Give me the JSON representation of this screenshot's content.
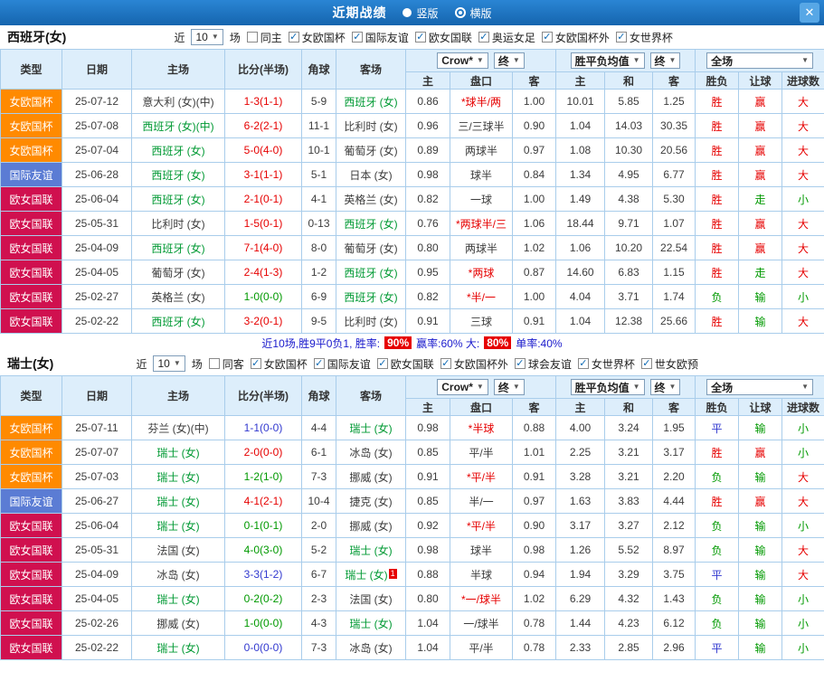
{
  "titlebar": {
    "title": "近期战绩",
    "radio_vertical": "竖版",
    "radio_horizontal": "横版",
    "close": "✕"
  },
  "colors": {
    "type_badge": {
      "女欧国杯": "#ff8a00",
      "国际友谊": "#5b7cd4",
      "欧女国联": "#d0104f"
    },
    "result": {
      "胜": "#e60000",
      "平": "#3239cf",
      "负": "#009900",
      "赢": "#e60000",
      "走": "#009900",
      "输": "#009900",
      "大": "#e60000",
      "小": "#009900"
    },
    "score": {
      "win": "#e60000",
      "draw": "#3239cf",
      "loss": "#009900"
    },
    "team_highlight": "#009933",
    "text": "#3c3c3c",
    "odds": "#3c3c3c",
    "line_star": "#e60000",
    "badge_bg": "#e60000"
  },
  "header": {
    "col_type": "类型",
    "col_date": "日期",
    "col_home": "主场",
    "col_score": "比分(半场)",
    "col_corner": "角球",
    "col_away": "客场",
    "dd_odds": "Crow*",
    "dd_final": "终",
    "dd_avg": "胜平负均值",
    "dd_scope": "全场",
    "sub": [
      "主",
      "盘口",
      "客",
      "主",
      "和",
      "客",
      "胜负",
      "让球",
      "进球数"
    ]
  },
  "sections": [
    {
      "team": "西班牙(女)",
      "filters": {
        "near_label": "近",
        "count": "10",
        "games_label": "场",
        "same": {
          "label": "同主",
          "checked": false
        },
        "leagues": [
          {
            "label": "女欧国杯",
            "checked": true
          },
          {
            "label": "国际友谊",
            "checked": true
          },
          {
            "label": "欧女国联",
            "checked": true
          },
          {
            "label": "奥运女足",
            "checked": true
          },
          {
            "label": "女欧国杯外",
            "checked": true
          },
          {
            "label": "女世界杯",
            "checked": true
          }
        ]
      },
      "rows": [
        {
          "type": "女欧国杯",
          "date": "25-07-12",
          "home": "意大利 (女)(中)",
          "home_hl": false,
          "score": "1-3(1-1)",
          "res": "win",
          "corner": "5-9",
          "away": "西班牙 (女)",
          "away_hl": true,
          "h": "0.86",
          "line": "*球半/两",
          "a": "1.00",
          "wh": "10.01",
          "wd": "5.85",
          "wa": "1.25",
          "r1": "胜",
          "r2": "赢",
          "r3": "大"
        },
        {
          "type": "女欧国杯",
          "date": "25-07-08",
          "home": "西班牙 (女)(中)",
          "home_hl": true,
          "score": "6-2(2-1)",
          "res": "win",
          "corner": "11-1",
          "away": "比利时 (女)",
          "away_hl": false,
          "h": "0.96",
          "line": "三/三球半",
          "a": "0.90",
          "wh": "1.04",
          "wd": "14.03",
          "wa": "30.35",
          "r1": "胜",
          "r2": "赢",
          "r3": "大"
        },
        {
          "type": "女欧国杯",
          "date": "25-07-04",
          "home": "西班牙 (女)",
          "home_hl": true,
          "score": "5-0(4-0)",
          "res": "win",
          "corner": "10-1",
          "away": "葡萄牙 (女)",
          "away_hl": false,
          "h": "0.89",
          "line": "两球半",
          "a": "0.97",
          "wh": "1.08",
          "wd": "10.30",
          "wa": "20.56",
          "r1": "胜",
          "r2": "赢",
          "r3": "大"
        },
        {
          "type": "国际友谊",
          "date": "25-06-28",
          "home": "西班牙 (女)",
          "home_hl": true,
          "score": "3-1(1-1)",
          "res": "win",
          "corner": "5-1",
          "away": "日本 (女)",
          "away_hl": false,
          "h": "0.98",
          "line": "球半",
          "a": "0.84",
          "wh": "1.34",
          "wd": "4.95",
          "wa": "6.77",
          "r1": "胜",
          "r2": "赢",
          "r3": "大"
        },
        {
          "type": "欧女国联",
          "date": "25-06-04",
          "home": "西班牙 (女)",
          "home_hl": true,
          "score": "2-1(0-1)",
          "res": "win",
          "corner": "4-1",
          "away": "英格兰 (女)",
          "away_hl": false,
          "h": "0.82",
          "line": "一球",
          "a": "1.00",
          "wh": "1.49",
          "wd": "4.38",
          "wa": "5.30",
          "r1": "胜",
          "r2": "走",
          "r3": "小"
        },
        {
          "type": "欧女国联",
          "date": "25-05-31",
          "home": "比利时 (女)",
          "home_hl": false,
          "score": "1-5(0-1)",
          "res": "win",
          "corner": "0-13",
          "away": "西班牙 (女)",
          "away_hl": true,
          "h": "0.76",
          "line": "*两球半/三",
          "a": "1.06",
          "wh": "18.44",
          "wd": "9.71",
          "wa": "1.07",
          "r1": "胜",
          "r2": "赢",
          "r3": "大"
        },
        {
          "type": "欧女国联",
          "date": "25-04-09",
          "home": "西班牙 (女)",
          "home_hl": true,
          "score": "7-1(4-0)",
          "res": "win",
          "corner": "8-0",
          "away": "葡萄牙 (女)",
          "away_hl": false,
          "h": "0.80",
          "line": "两球半",
          "a": "1.02",
          "wh": "1.06",
          "wd": "10.20",
          "wa": "22.54",
          "r1": "胜",
          "r2": "赢",
          "r3": "大"
        },
        {
          "type": "欧女国联",
          "date": "25-04-05",
          "home": "葡萄牙 (女)",
          "home_hl": false,
          "score": "2-4(1-3)",
          "res": "win",
          "corner": "1-2",
          "away": "西班牙 (女)",
          "away_hl": true,
          "h": "0.95",
          "line": "*两球",
          "a": "0.87",
          "wh": "14.60",
          "wd": "6.83",
          "wa": "1.15",
          "r1": "胜",
          "r2": "走",
          "r3": "大"
        },
        {
          "type": "欧女国联",
          "date": "25-02-27",
          "home": "英格兰 (女)",
          "home_hl": false,
          "score": "1-0(0-0)",
          "res": "loss",
          "corner": "6-9",
          "away": "西班牙 (女)",
          "away_hl": true,
          "h": "0.82",
          "line": "*半/一",
          "a": "1.00",
          "wh": "4.04",
          "wd": "3.71",
          "wa": "1.74",
          "r1": "负",
          "r2": "输",
          "r3": "小"
        },
        {
          "type": "欧女国联",
          "date": "25-02-22",
          "home": "西班牙 (女)",
          "home_hl": true,
          "score": "3-2(0-1)",
          "res": "win",
          "corner": "9-5",
          "away": "比利时 (女)",
          "away_hl": false,
          "h": "0.91",
          "line": "三球",
          "a": "0.91",
          "wh": "1.04",
          "wd": "12.38",
          "wa": "25.66",
          "r1": "胜",
          "r2": "输",
          "r3": "大"
        }
      ],
      "summary": {
        "prefix": "近10场,胜9平0负1, 胜率:",
        "win_rate": "90%",
        "mid": "赢率:60% 大:",
        "big_rate": "80%",
        "suffix": "单率:40%"
      }
    },
    {
      "team": "瑞士(女)",
      "filters": {
        "near_label": "近",
        "count": "10",
        "games_label": "场",
        "same": {
          "label": "同客",
          "checked": false
        },
        "leagues": [
          {
            "label": "女欧国杯",
            "checked": true
          },
          {
            "label": "国际友谊",
            "checked": true
          },
          {
            "label": "欧女国联",
            "checked": true
          },
          {
            "label": "女欧国杯外",
            "checked": true
          },
          {
            "label": "球会友谊",
            "checked": true
          },
          {
            "label": "女世界杯",
            "checked": true
          },
          {
            "label": "世女欧预",
            "checked": true
          }
        ]
      },
      "rows": [
        {
          "type": "女欧国杯",
          "date": "25-07-11",
          "home": "芬兰 (女)(中)",
          "home_hl": false,
          "score": "1-1(0-0)",
          "res": "draw",
          "corner": "4-4",
          "away": "瑞士 (女)",
          "away_hl": true,
          "h": "0.98",
          "line": "*半球",
          "a": "0.88",
          "wh": "4.00",
          "wd": "3.24",
          "wa": "1.95",
          "r1": "平",
          "r2": "输",
          "r3": "小"
        },
        {
          "type": "女欧国杯",
          "date": "25-07-07",
          "home": "瑞士 (女)",
          "home_hl": true,
          "score": "2-0(0-0)",
          "res": "win",
          "corner": "6-1",
          "away": "冰岛 (女)",
          "away_hl": false,
          "h": "0.85",
          "line": "平/半",
          "a": "1.01",
          "wh": "2.25",
          "wd": "3.21",
          "wa": "3.17",
          "r1": "胜",
          "r2": "赢",
          "r3": "小"
        },
        {
          "type": "女欧国杯",
          "date": "25-07-03",
          "home": "瑞士 (女)",
          "home_hl": true,
          "score": "1-2(1-0)",
          "res": "loss",
          "corner": "7-3",
          "away": "挪威 (女)",
          "away_hl": false,
          "h": "0.91",
          "line": "*平/半",
          "a": "0.91",
          "wh": "3.28",
          "wd": "3.21",
          "wa": "2.20",
          "r1": "负",
          "r2": "输",
          "r3": "大"
        },
        {
          "type": "国际友谊",
          "date": "25-06-27",
          "home": "瑞士 (女)",
          "home_hl": true,
          "score": "4-1(2-1)",
          "res": "win",
          "corner": "10-4",
          "away": "捷克 (女)",
          "away_hl": false,
          "h": "0.85",
          "line": "半/一",
          "a": "0.97",
          "wh": "1.63",
          "wd": "3.83",
          "wa": "4.44",
          "r1": "胜",
          "r2": "赢",
          "r3": "大"
        },
        {
          "type": "欧女国联",
          "date": "25-06-04",
          "home": "瑞士 (女)",
          "home_hl": true,
          "score": "0-1(0-1)",
          "res": "loss",
          "corner": "2-0",
          "away": "挪威 (女)",
          "away_hl": false,
          "h": "0.92",
          "line": "*平/半",
          "a": "0.90",
          "wh": "3.17",
          "wd": "3.27",
          "wa": "2.12",
          "r1": "负",
          "r2": "输",
          "r3": "小"
        },
        {
          "type": "欧女国联",
          "date": "25-05-31",
          "home": "法国 (女)",
          "home_hl": false,
          "score": "4-0(3-0)",
          "res": "loss",
          "corner": "5-2",
          "away": "瑞士 (女)",
          "away_hl": true,
          "h": "0.98",
          "line": "球半",
          "a": "0.98",
          "wh": "1.26",
          "wd": "5.52",
          "wa": "8.97",
          "r1": "负",
          "r2": "输",
          "r3": "大"
        },
        {
          "type": "欧女国联",
          "date": "25-04-09",
          "home": "冰岛 (女)",
          "home_hl": false,
          "score": "3-3(1-2)",
          "res": "draw",
          "corner": "6-7",
          "away": "瑞士 (女)",
          "away_hl": true,
          "card": "1",
          "h": "0.88",
          "line": "半球",
          "a": "0.94",
          "wh": "1.94",
          "wd": "3.29",
          "wa": "3.75",
          "r1": "平",
          "r2": "输",
          "r3": "大"
        },
        {
          "type": "欧女国联",
          "date": "25-04-05",
          "home": "瑞士 (女)",
          "home_hl": true,
          "score": "0-2(0-2)",
          "res": "loss",
          "corner": "2-3",
          "away": "法国 (女)",
          "away_hl": false,
          "h": "0.80",
          "line": "*一/球半",
          "a": "1.02",
          "wh": "6.29",
          "wd": "4.32",
          "wa": "1.43",
          "r1": "负",
          "r2": "输",
          "r3": "小"
        },
        {
          "type": "欧女国联",
          "date": "25-02-26",
          "home": "挪威 (女)",
          "home_hl": false,
          "score": "1-0(0-0)",
          "res": "loss",
          "corner": "4-3",
          "away": "瑞士 (女)",
          "away_hl": true,
          "h": "1.04",
          "line": "一/球半",
          "a": "0.78",
          "wh": "1.44",
          "wd": "4.23",
          "wa": "6.12",
          "r1": "负",
          "r2": "输",
          "r3": "小"
        },
        {
          "type": "欧女国联",
          "date": "25-02-22",
          "home": "瑞士 (女)",
          "home_hl": true,
          "score": "0-0(0-0)",
          "res": "draw",
          "corner": "7-3",
          "away": "冰岛 (女)",
          "away_hl": false,
          "h": "1.04",
          "line": "平/半",
          "a": "0.78",
          "wh": "2.33",
          "wd": "2.85",
          "wa": "2.96",
          "r1": "平",
          "r2": "输",
          "r3": "小"
        }
      ]
    }
  ]
}
